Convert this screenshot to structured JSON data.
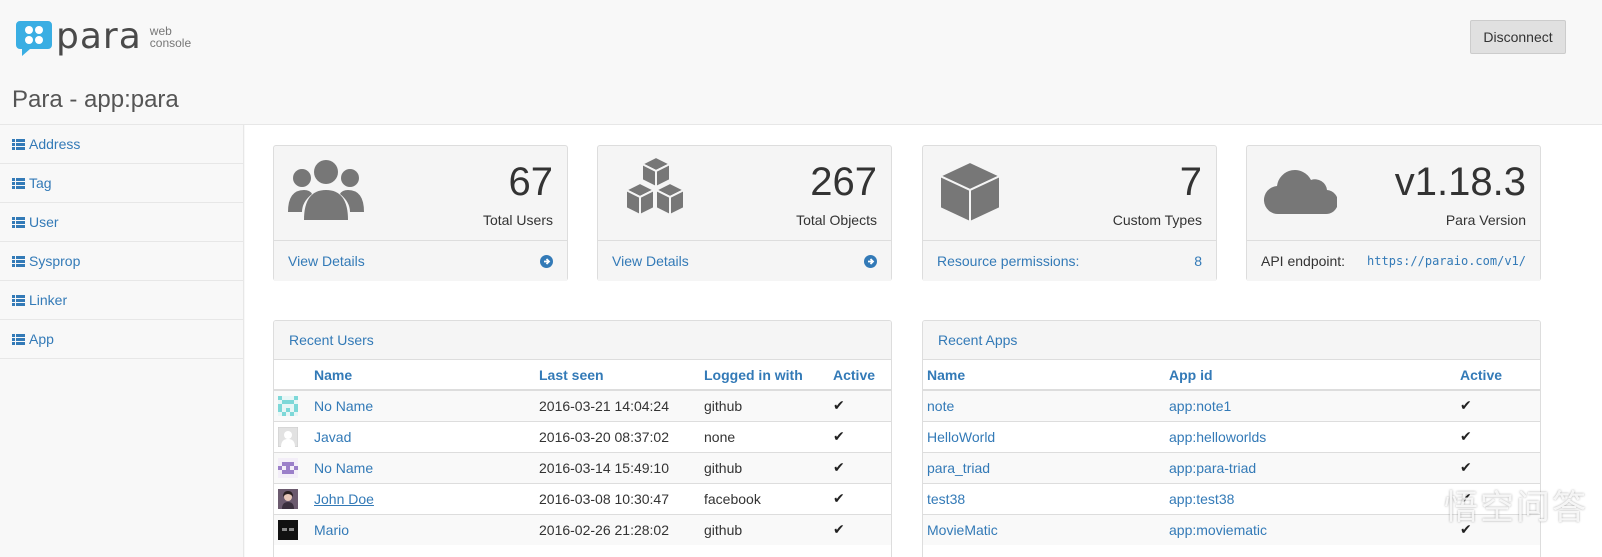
{
  "header": {
    "logo_word": "para",
    "logo_sub": "web console",
    "disconnect_label": "Disconnect",
    "page_title": "Para - app:para"
  },
  "sidebar": {
    "items": [
      {
        "label": "Address"
      },
      {
        "label": "Tag"
      },
      {
        "label": "User"
      },
      {
        "label": "Sysprop"
      },
      {
        "label": "Linker"
      },
      {
        "label": "App"
      }
    ]
  },
  "cards": [
    {
      "value": "67",
      "label": "Total Users",
      "foot_left": "View Details",
      "icon": "users-icon"
    },
    {
      "value": "267",
      "label": "Total Objects",
      "foot_left": "View Details",
      "icon": "cubes-icon"
    },
    {
      "value": "7",
      "label": "Custom Types",
      "foot_left": "Resource permissions:",
      "foot_right": "8",
      "icon": "cube-icon"
    },
    {
      "value": "v1.18.3",
      "label": "Para Version",
      "foot_left": "API endpoint:",
      "foot_right": "https://paraio.com/v1/",
      "icon": "cloud-icon"
    }
  ],
  "recent_users": {
    "title": "Recent Users",
    "columns": [
      "Name",
      "Last seen",
      "Logged in with",
      "Active"
    ],
    "rows": [
      {
        "name": "No Name",
        "last_seen": "2016-03-21 14:04:24",
        "provider": "github",
        "active": "✔"
      },
      {
        "name": "Javad",
        "last_seen": "2016-03-20 08:37:02",
        "provider": "none",
        "active": "✔"
      },
      {
        "name": "No Name",
        "last_seen": "2016-03-14 15:49:10",
        "provider": "github",
        "active": "✔"
      },
      {
        "name": "John Doe",
        "last_seen": "2016-03-08 10:30:47",
        "provider": "facebook",
        "active": "✔"
      },
      {
        "name": "Mario",
        "last_seen": "2016-02-26 21:28:02",
        "provider": "github",
        "active": "✔"
      }
    ]
  },
  "recent_apps": {
    "title": "Recent Apps",
    "columns": [
      "Name",
      "App id",
      "Active"
    ],
    "rows": [
      {
        "name": "note",
        "app_id": "app:note1",
        "active": "✔"
      },
      {
        "name": "HelloWorld",
        "app_id": "app:helloworlds",
        "active": "✔"
      },
      {
        "name": "para_triad",
        "app_id": "app:para-triad",
        "active": "✔"
      },
      {
        "name": "test38",
        "app_id": "app:test38",
        "active": "✔"
      },
      {
        "name": "MovieMatic",
        "app_id": "app:moviematic",
        "active": "✔"
      }
    ]
  },
  "watermark": "悟空问答",
  "colors": {
    "link": "#337ab7",
    "icon": "#777777"
  }
}
